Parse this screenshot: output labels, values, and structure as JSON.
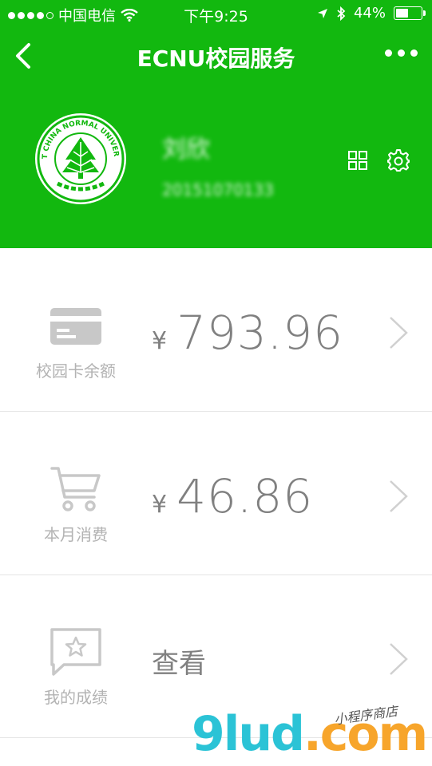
{
  "status_bar": {
    "carrier": "中国电信",
    "time": "下午9:25",
    "battery": "44%",
    "battery_level_percent": 44
  },
  "navbar": {
    "title": "ECNU校园服务"
  },
  "profile": {
    "name": "刘欣",
    "student_id": "20151070133",
    "logo_text": "EAST CHINA NORMAL UNIVERSITY"
  },
  "rows": [
    {
      "label": "校园卡余额",
      "currency": "¥",
      "value": "793.96",
      "icon": "card-icon"
    },
    {
      "label": "本月消费",
      "currency": "¥",
      "value": "46.86",
      "icon": "cart-icon"
    },
    {
      "label": "我的成绩",
      "value": "查看",
      "icon": "star-chat-icon"
    }
  ],
  "watermark": {
    "main": "9lud",
    "suffix": ".com",
    "sub": "小程序商店"
  },
  "colors": {
    "brand_green": "#12b80f",
    "icon_gray": "#c8c8c8",
    "text_gray": "#808080",
    "label_gray": "#b3b3b3"
  }
}
